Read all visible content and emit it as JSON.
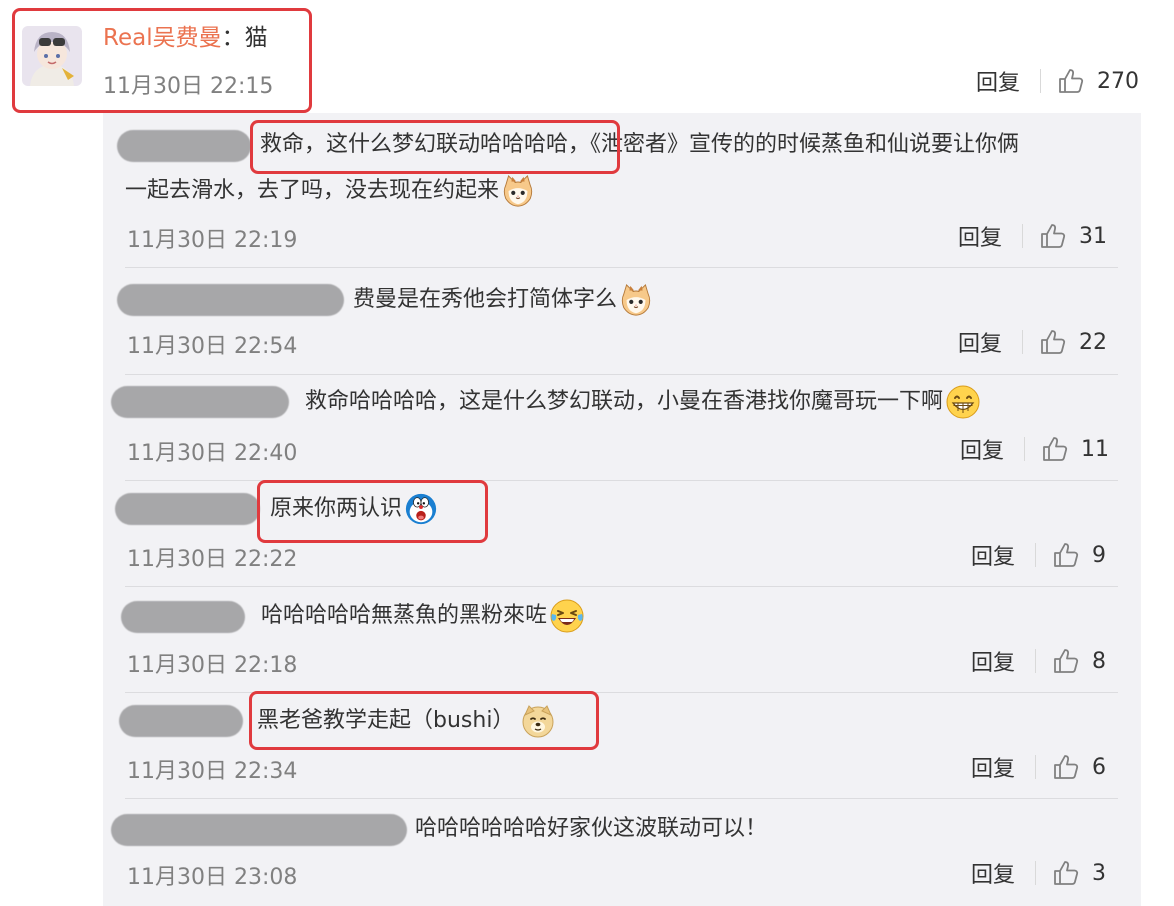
{
  "main_comment": {
    "username": "Real吴费曼",
    "separator": "：",
    "text": "猫",
    "time": "11月30日 22:15",
    "reply_label": "回复",
    "likes": "270"
  },
  "replies": [
    {
      "text_line1": "救命，这什么梦幻联动哈哈哈哈，《泄密者》宣传的的时候蒸鱼和仙说要让你俩",
      "text_line2": "一起去滑水，去了吗，没去现在约起来",
      "emoji": "cat-face-emoji",
      "time": "11月30日 22:19",
      "reply_label": "回复",
      "likes": "31"
    },
    {
      "text": "费曼是在秀他会打简体字么",
      "emoji": "cat-face-emoji",
      "time": "11月30日 22:54",
      "reply_label": "回复",
      "likes": "22"
    },
    {
      "text": "救命哈哈哈哈，这是什么梦幻联动，小曼在香港找你魔哥玩一下啊",
      "emoji": "grin-emoji",
      "time": "11月30日 22:40",
      "reply_label": "回复",
      "likes": "11"
    },
    {
      "text": "原来你两认识",
      "emoji": "doraemon-shocked-emoji",
      "time": "11月30日 22:22",
      "reply_label": "回复",
      "likes": "9"
    },
    {
      "text": "哈哈哈哈哈無蒸魚的黑粉來咗",
      "emoji": "laugh-cry-emoji",
      "time": "11月30日 22:18",
      "reply_label": "回复",
      "likes": "8"
    },
    {
      "text": "黑老爸教学走起（bushi）",
      "emoji": "doge-emoji",
      "time": "11月30日 22:34",
      "reply_label": "回复",
      "likes": "6"
    },
    {
      "text": "哈哈哈哈哈哈好家伙这波联动可以！",
      "emoji": "",
      "time": "11月30日 23:08",
      "reply_label": "回复",
      "likes": "3"
    }
  ],
  "colors": {
    "username": "#eb7350",
    "highlight_box": "#e03a3e",
    "reply_background": "#f2f2f5",
    "timestamp": "#808080"
  }
}
